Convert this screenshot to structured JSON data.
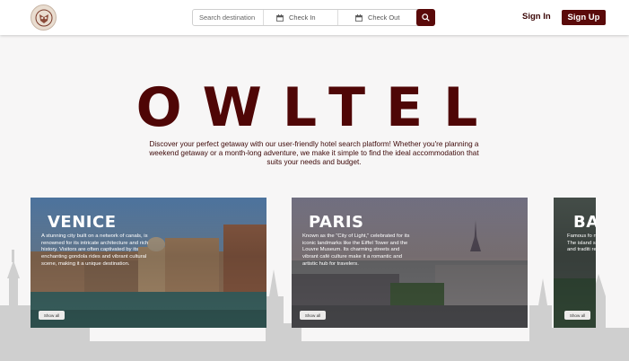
{
  "header": {
    "search_placeholder": "Search destination",
    "check_in_label": "Check In",
    "check_out_label": "Check Out",
    "sign_in_label": "Sign In",
    "sign_up_label": "Sign Up"
  },
  "hero": {
    "title": "OWLTEL",
    "description": "Discover your perfect getaway with our user-friendly hotel search platform! Whether you're planning a weekend getaway or a month-long adventure, we make it simple to find the ideal accommodation that suits your needs and budget."
  },
  "destinations": [
    {
      "name": "VENICE",
      "description": "A stunning city built on a network of canals, is renowned for its intricate architecture and rich history. Visitors are often captivated by its enchanting gondola rides and vibrant cultural scene, making it a unique destination.",
      "button_label": "Show all"
    },
    {
      "name": "PARIS",
      "description": "Known as the \"City of Light,\" celebrated for its iconic landmarks like the Eiffel Tower and the Louvre Museum. Its charming streets and vibrant café culture make it a romantic and artistic hub for travelers.",
      "button_label": "Show all"
    },
    {
      "name": "BA",
      "description": "Famous fo nice terrac The island spirituality and traditi relaxation",
      "button_label": "Show all"
    }
  ],
  "colors": {
    "brand": "#5a0a0a",
    "title": "#4f0606",
    "background": "#f7f6f6"
  },
  "icons": {
    "logo": "owl-logo",
    "calendar": "calendar-icon",
    "search": "search-icon"
  }
}
